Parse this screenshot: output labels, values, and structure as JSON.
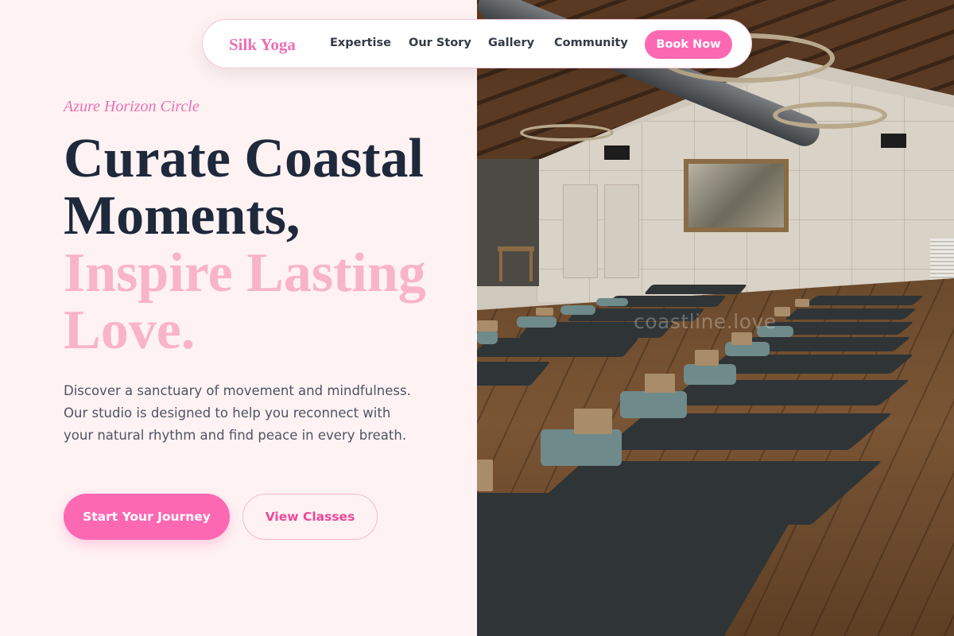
{
  "nav": {
    "logo": "Silk Yoga",
    "links": [
      {
        "label": "Expertise"
      },
      {
        "label": "Our Story"
      },
      {
        "label": "Gallery"
      },
      {
        "label": "Community"
      }
    ],
    "cta_label": "Book Now"
  },
  "hero": {
    "tagline": "Azure Horizon Circle",
    "headline_dark_line1": "Curate Coastal",
    "headline_dark_line2": "Moments,",
    "headline_pink_line1": "Inspire Lasting",
    "headline_pink_line2": "Love.",
    "description": "Discover a sanctuary of movement and mindfulness. Our studio is designed to help you reconnect with your natural rhythm and find peace in every breath.",
    "primary_cta": "Start Your Journey",
    "secondary_cta": "View Classes"
  },
  "photo": {
    "watermark": "coastline.love",
    "subject": "yoga studio with mats, blocks and towels on wooden floor"
  },
  "colors": {
    "accent_pink": "#fd68b3",
    "brand_pink_text": "#ec6fb4",
    "soft_pink_heading": "#f9b4c8",
    "dark_heading": "#1e293b",
    "page_background": "#fff2f3"
  }
}
